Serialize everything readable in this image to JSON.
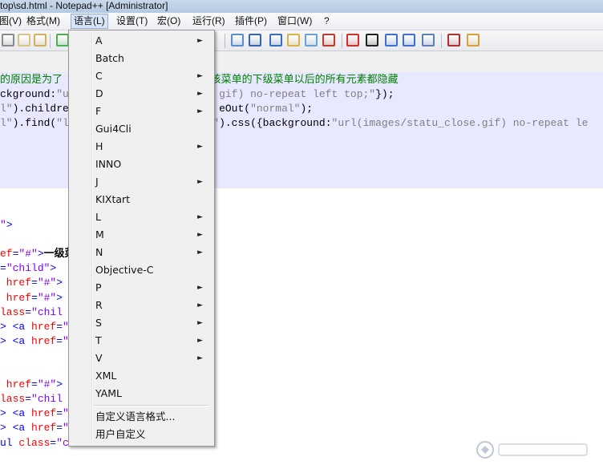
{
  "window": {
    "title": "top\\sd.html - Notepad++ [Administrator]"
  },
  "menubar": {
    "items": [
      "图(V)",
      "格式(M)",
      "语言(L)",
      "设置(T)",
      "宏(O)",
      "运行(R)",
      "插件(P)",
      "窗口(W)",
      "?"
    ],
    "active_index": 2
  },
  "editor": {
    "lines": [
      {
        "t": "comment",
        "segs": [
          [
            "c-comment",
            "的原因是为了"
          ],
          [
            "c-comment",
            "                      "
          ],
          [
            "c-comment",
            "将该菜单的下级菜单以后的所有元素都隐藏"
          ]
        ]
      },
      {
        "t": "code",
        "segs": [
          [
            "c-black",
            "ckground:"
          ],
          [
            "c-str",
            "\"u"
          ],
          [
            "c-black",
            "                        "
          ],
          [
            "c-str",
            "gif) no-repeat left top;\""
          ],
          [
            "c-black",
            "});"
          ]
        ]
      },
      {
        "t": "code",
        "segs": [
          [
            "c-str",
            "l\""
          ],
          [
            "c-black",
            ").childre"
          ],
          [
            "c-black",
            "                        "
          ],
          [
            "c-black",
            "eOut("
          ],
          [
            "c-str",
            "\"normal\""
          ],
          [
            "c-black",
            ");"
          ]
        ]
      },
      {
        "t": "code",
        "segs": [
          [
            "c-str",
            "l\""
          ],
          [
            "c-black",
            ").find("
          ],
          [
            "c-str",
            "\"l"
          ],
          [
            "c-black",
            "                      "
          ],
          [
            "c-str",
            "a\""
          ],
          [
            "c-black",
            ").css({background:"
          ],
          [
            "c-str",
            "\"url(images/statu_close.gif) no-repeat le"
          ]
        ]
      },
      {
        "t": "blank",
        "segs": []
      },
      {
        "t": "blank",
        "segs": []
      },
      {
        "t": "blank",
        "segs": []
      },
      {
        "t": "blank",
        "segs": []
      },
      {
        "t": "blank",
        "segs": []
      },
      {
        "t": "blank",
        "segs": []
      },
      {
        "t": "code",
        "segs": [
          [
            "c-val",
            "\""
          ],
          [
            "c-blue",
            ">"
          ]
        ]
      },
      {
        "t": "blank",
        "segs": []
      },
      {
        "t": "code",
        "segs": [
          [
            "c-attr",
            "ef"
          ],
          [
            "c-blue",
            "="
          ],
          [
            "c-val",
            "\"#\""
          ],
          [
            "c-blue",
            ">"
          ],
          [
            "c-bold",
            "一级菜"
          ]
        ]
      },
      {
        "t": "code",
        "segs": [
          [
            "c-blue",
            "="
          ],
          [
            "c-val",
            "\"child\""
          ],
          [
            "c-blue",
            ">"
          ]
        ]
      },
      {
        "t": "code",
        "segs": [
          [
            "c-attr",
            " href"
          ],
          [
            "c-blue",
            "="
          ],
          [
            "c-val",
            "\"#\""
          ],
          [
            "c-blue",
            ">"
          ]
        ]
      },
      {
        "t": "code",
        "segs": [
          [
            "c-attr",
            " href"
          ],
          [
            "c-blue",
            "="
          ],
          [
            "c-val",
            "\"#\""
          ],
          [
            "c-blue",
            ">"
          ]
        ]
      },
      {
        "t": "code",
        "segs": [
          [
            "c-attr",
            "lass"
          ],
          [
            "c-blue",
            "="
          ],
          [
            "c-val",
            "\"chil"
          ]
        ]
      },
      {
        "t": "code",
        "segs": [
          [
            "c-blue",
            "> <a "
          ],
          [
            "c-attr",
            "href"
          ],
          [
            "c-blue",
            "="
          ],
          [
            "c-val",
            "\""
          ]
        ]
      },
      {
        "t": "code",
        "segs": [
          [
            "c-blue",
            "> <a "
          ],
          [
            "c-attr",
            "href"
          ],
          [
            "c-blue",
            "="
          ],
          [
            "c-val",
            "\""
          ]
        ]
      },
      {
        "t": "blank",
        "segs": []
      },
      {
        "t": "blank",
        "segs": []
      },
      {
        "t": "code",
        "segs": [
          [
            "c-attr",
            " href"
          ],
          [
            "c-blue",
            "="
          ],
          [
            "c-val",
            "\"#\""
          ],
          [
            "c-blue",
            ">"
          ]
        ]
      },
      {
        "t": "code",
        "segs": [
          [
            "c-attr",
            "lass"
          ],
          [
            "c-blue",
            "="
          ],
          [
            "c-val",
            "\"chil"
          ]
        ]
      },
      {
        "t": "code",
        "segs": [
          [
            "c-blue",
            "> <a "
          ],
          [
            "c-attr",
            "href"
          ],
          [
            "c-blue",
            "="
          ],
          [
            "c-val",
            "\""
          ]
        ]
      },
      {
        "t": "code",
        "segs": [
          [
            "c-blue",
            "> <a "
          ],
          [
            "c-attr",
            "href"
          ],
          [
            "c-blue",
            "="
          ],
          [
            "c-val",
            "\""
          ]
        ]
      },
      {
        "t": "code",
        "segs": [
          [
            "c-blue",
            "ul "
          ],
          [
            "c-attr",
            "class"
          ],
          [
            "c-blue",
            "="
          ],
          [
            "c-val",
            "\"child\""
          ],
          [
            "c-blue",
            ">"
          ]
        ]
      }
    ]
  },
  "language_menu": {
    "items": [
      {
        "label": "A",
        "submenu": true
      },
      {
        "label": "Batch",
        "submenu": false
      },
      {
        "label": "C",
        "submenu": true
      },
      {
        "label": "D",
        "submenu": true
      },
      {
        "label": "F",
        "submenu": true
      },
      {
        "label": "Gui4Cli",
        "submenu": false
      },
      {
        "label": "H",
        "submenu": true
      },
      {
        "label": "INNO",
        "submenu": false
      },
      {
        "label": "J",
        "submenu": true
      },
      {
        "label": "KIXtart",
        "submenu": false
      },
      {
        "label": "L",
        "submenu": true
      },
      {
        "label": "M",
        "submenu": true
      },
      {
        "label": "N",
        "submenu": true
      },
      {
        "label": "Objective-C",
        "submenu": false
      },
      {
        "label": "P",
        "submenu": true
      },
      {
        "label": "R",
        "submenu": true
      },
      {
        "label": "S",
        "submenu": true
      },
      {
        "label": "T",
        "submenu": true
      },
      {
        "label": "V",
        "submenu": true
      },
      {
        "label": "XML",
        "submenu": false
      },
      {
        "label": "YAML",
        "submenu": false
      }
    ],
    "footer_items": [
      "自定义语言格式...",
      "用户自定义"
    ]
  },
  "icons": {
    "submenu_arrow": "►"
  }
}
